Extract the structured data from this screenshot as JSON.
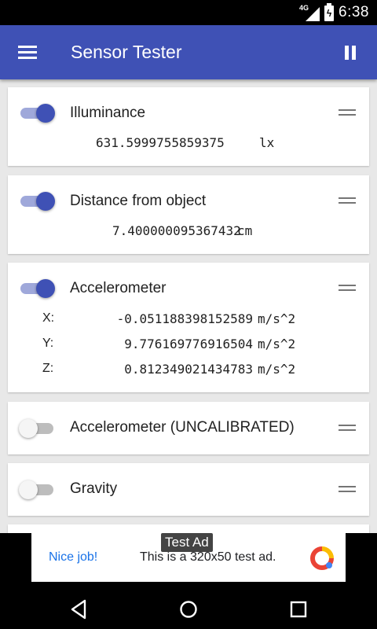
{
  "status_bar": {
    "network": "4G",
    "time": "6:38",
    "icons": [
      "signal-icon",
      "battery-charging-icon"
    ]
  },
  "app_bar": {
    "title": "Sensor Tester",
    "icons": [
      "menu-icon",
      "pause-icon"
    ]
  },
  "sensors": [
    {
      "name": "Illuminance",
      "enabled": true,
      "value": "631.5999755859375",
      "unit": "lx"
    },
    {
      "name": "Distance from object",
      "enabled": true,
      "value": "7.400000095367432",
      "unit": "cm"
    },
    {
      "name": "Accelerometer",
      "enabled": true,
      "axes": [
        {
          "label": "X:",
          "value": "-0.051188398152589",
          "unit": "m/s^2"
        },
        {
          "label": "Y:",
          "value": "9.776169776916504",
          "unit": "m/s^2"
        },
        {
          "label": "Z:",
          "value": "0.812349021434783",
          "unit": "m/s^2"
        }
      ]
    },
    {
      "name": "Accelerometer (UNCALIBRATED)",
      "enabled": false
    },
    {
      "name": "Gravity",
      "enabled": false
    }
  ],
  "ad": {
    "tag": "Test Ad",
    "headline": "Nice job!",
    "body": "This is a 320x50 test ad."
  },
  "nav_bar": {
    "icons": [
      "back-icon",
      "home-icon",
      "recent-apps-icon"
    ]
  },
  "colors": {
    "primary": "#3F51B5",
    "switch_track_on": "#9FA8DA",
    "background": "#E8E8E8",
    "ad_link": "#1A73E8"
  }
}
